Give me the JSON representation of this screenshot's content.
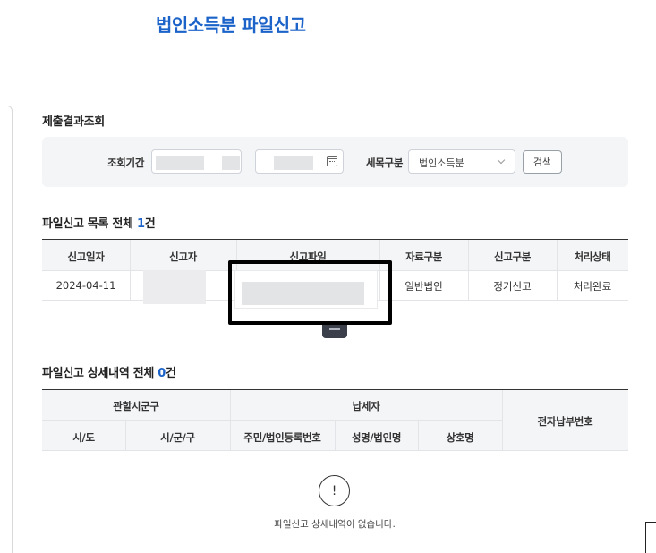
{
  "page": {
    "title": "법인소득분 파일신고"
  },
  "search": {
    "section_title": "제출결과조회",
    "period_label": "조회기간",
    "tax_type_label": "세목구분",
    "tax_type_value": "법인소득분",
    "search_button": "검색"
  },
  "file_list": {
    "title_prefix": "파일신고 목록 전체 ",
    "count": "1",
    "count_suffix": "건",
    "headers": [
      "신고일자",
      "신고자",
      "신고파일",
      "자료구분",
      "신고구분",
      "처리상태"
    ],
    "rows": [
      {
        "date": "2024-04-11",
        "data_type": "일반법인",
        "report_type": "정기신고",
        "status": "처리완료"
      }
    ]
  },
  "detail_list": {
    "title_prefix": "파일신고 상세내역 전체 ",
    "count": "0",
    "count_suffix": "건",
    "group_headers": {
      "jurisdiction": "관할시군구",
      "taxpayer": "납세자",
      "payment_no": "전자납부번호"
    },
    "sub_headers": [
      "시/도",
      "시/군/구",
      "주민/법인등록번호",
      "성명/법인명",
      "상호명"
    ],
    "empty_icon_glyph": "!",
    "empty_message": "파일신고 상세내역이 없습니다."
  },
  "colors": {
    "accent": "#1b63c9",
    "header_bg": "#f4f5f7"
  }
}
